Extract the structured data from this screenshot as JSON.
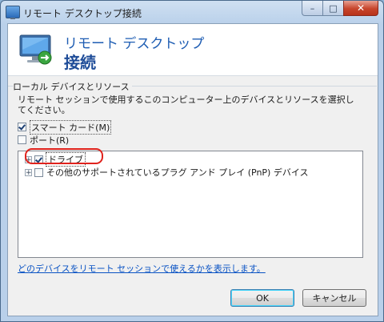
{
  "window": {
    "title": "リモート デスクトップ接続",
    "buttons": {
      "minimize": "–",
      "maximize": "□",
      "close": "✕"
    }
  },
  "header": {
    "line1": "リモート デスクトップ",
    "line2": "接続"
  },
  "group": {
    "label": "ローカル デバイスとリソース",
    "description": "リモート セッションで使用するこのコンピューター上のデバイスとリソースを選択してください。"
  },
  "checkboxes": [
    {
      "label": "スマート カード(M)",
      "checked": true
    },
    {
      "label": "ポート(R)",
      "checked": false
    }
  ],
  "tree": {
    "items": [
      {
        "expander": "+",
        "label": "ドライブ",
        "checked": true
      },
      {
        "expander": "+",
        "label": "その他のサポートされているプラグ アンド プレイ (PnP) デバイス",
        "checked": false
      }
    ]
  },
  "link": "どのデバイスをリモート セッションで使えるかを表示します。",
  "footer": {
    "ok_label": "OK",
    "cancel_label": "キャンセル"
  },
  "colors": {
    "accent": "#1e5db3",
    "highlight_ring": "#e0231d",
    "link": "#0a53c4"
  },
  "icons": [
    "remote-desktop-icon",
    "plus-expander-icon",
    "checkmark-icon"
  ]
}
